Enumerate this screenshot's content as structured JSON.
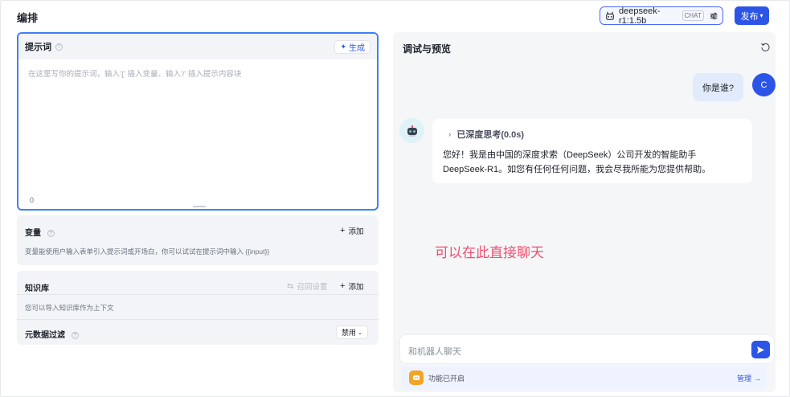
{
  "header": {
    "title": "编排",
    "model": {
      "name": "deepseek-r1:1.5b",
      "tag": "CHAT"
    },
    "publish_label": "发布"
  },
  "prompt": {
    "label": "提示词",
    "generate_label": "生成",
    "placeholder": "在这里写你的提示词，输入'{' 插入变量、输入'/' 插入提示内容块",
    "char_count": "0"
  },
  "variables": {
    "label": "变量",
    "add_label": "添加",
    "description": "变量能使用户输入表单引入提示词或开场白，你可以试试在提示词中输入 {{input}}"
  },
  "knowledge": {
    "label": "知识库",
    "recall_label": "召回设置",
    "add_label": "添加",
    "description": "您可以导入知识库作为上下文",
    "metadata_label": "元数据过滤",
    "metadata_value": "禁用"
  },
  "preview": {
    "title": "调试与预览",
    "user_message": "你是谁?",
    "user_initial": "C",
    "thinking_label": "已深度思考(0.0s)",
    "bot_reply": "您好！我是由中国的深度求索（DeepSeek）公司开发的智能助手DeepSeek-R1。如您有任何任何问题，我会尽我所能为您提供帮助。",
    "annotation": "可以在此直接聊天",
    "input_placeholder": "和机器人聊天",
    "features_label": "功能已开启",
    "manage_label": "管理"
  },
  "colors": {
    "accent": "#2c55e8",
    "annotation": "#f0506e",
    "user_bubble": "#e1ebfb",
    "feature_icon": "#f3a327"
  }
}
